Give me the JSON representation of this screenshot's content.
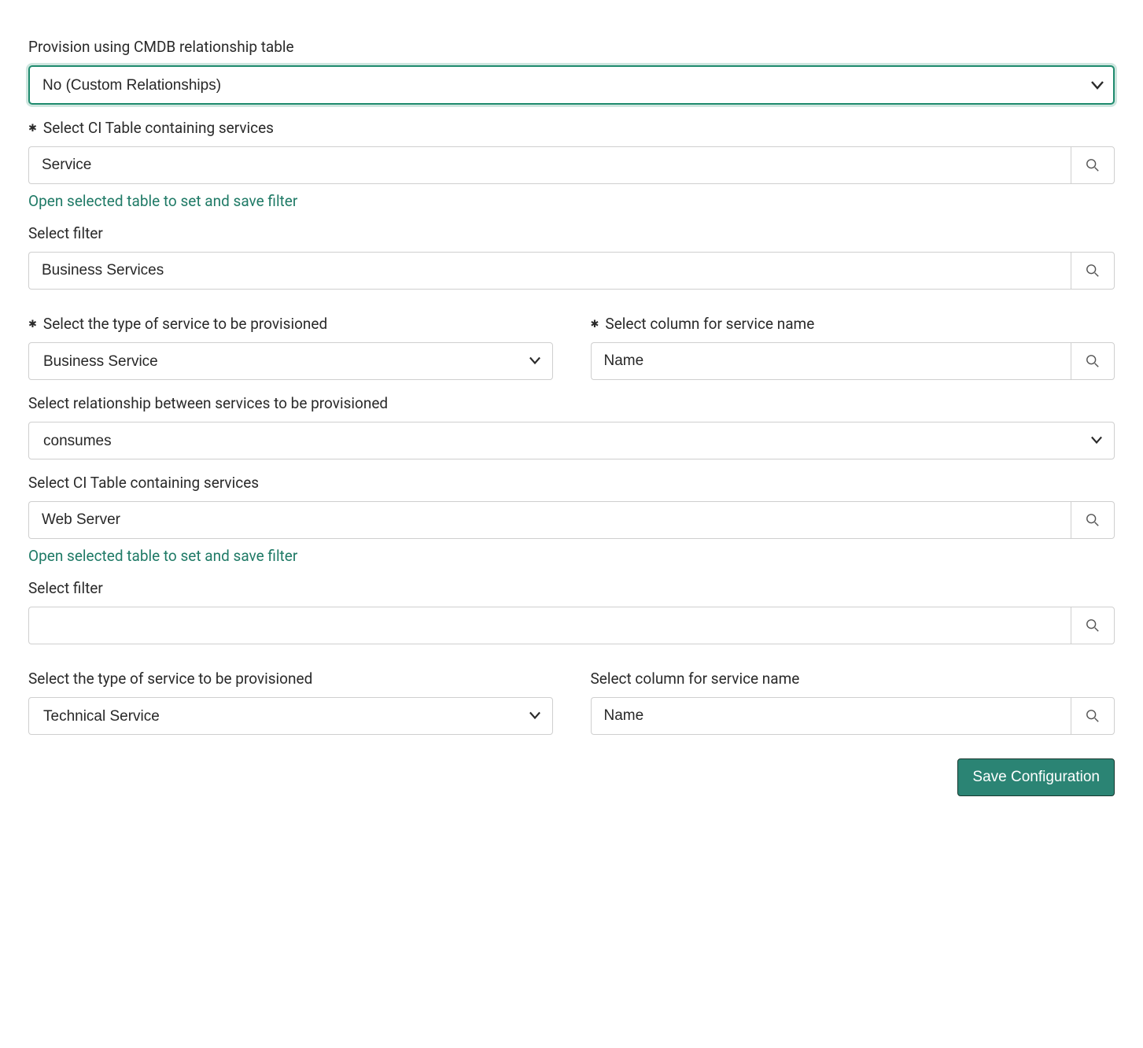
{
  "provision": {
    "label": "Provision using CMDB relationship table",
    "value": "No (Custom Relationships)"
  },
  "ci_table_1": {
    "label": "Select CI Table containing services",
    "value": "Service",
    "help_link": "Open selected table to set and save filter"
  },
  "filter_1": {
    "label": "Select filter",
    "value": "Business Services"
  },
  "service_type_1": {
    "label": "Select the type of service to be provisioned",
    "value": "Business Service"
  },
  "service_name_col_1": {
    "label": "Select column for service name",
    "value": "Name"
  },
  "relationship": {
    "label": "Select relationship between services to be provisioned",
    "value": "consumes"
  },
  "ci_table_2": {
    "label": "Select CI Table containing services",
    "value": "Web Server",
    "help_link": "Open selected table to set and save filter"
  },
  "filter_2": {
    "label": "Select filter",
    "value": ""
  },
  "service_type_2": {
    "label": "Select the type of service to be provisioned",
    "value": "Technical Service"
  },
  "service_name_col_2": {
    "label": "Select column for service name",
    "value": "Name"
  },
  "buttons": {
    "save": "Save Configuration"
  }
}
